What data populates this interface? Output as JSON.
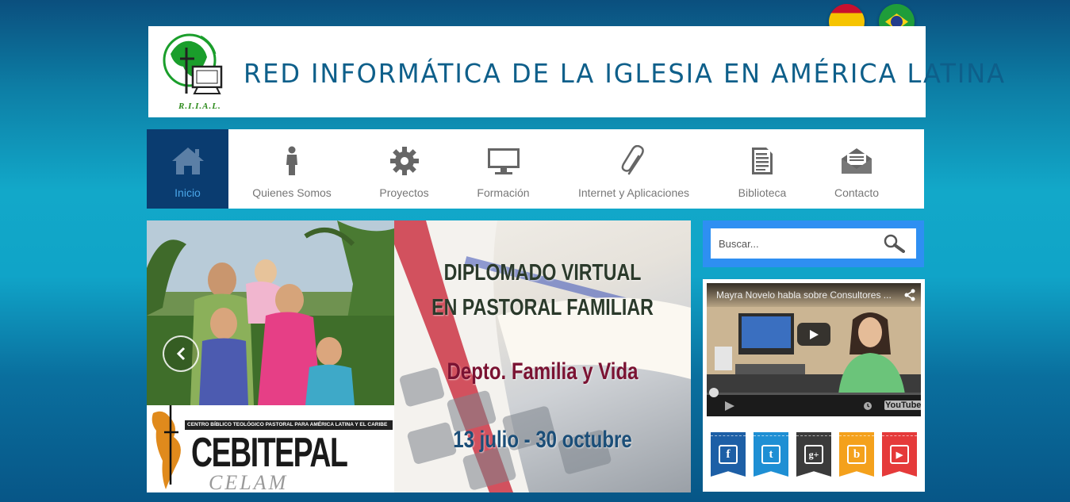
{
  "languages": [
    {
      "name": "Español",
      "flag": "spain-flag"
    },
    {
      "name": "Português",
      "flag": "brazil-flag"
    }
  ],
  "header": {
    "logo_text": "R.I.I.A.L.",
    "title": "RED INFORMÁTICA DE LA IGLESIA EN AMÉRICA LATINA"
  },
  "nav": {
    "items": [
      {
        "label": "Inicio",
        "icon": "home-icon",
        "active": true
      },
      {
        "label": "Quienes Somos",
        "icon": "person-icon"
      },
      {
        "label": "Proyectos",
        "icon": "gear-icon"
      },
      {
        "label": "Formación",
        "icon": "monitor-icon"
      },
      {
        "label": "Internet y Aplicaciones",
        "icon": "paperclip-icon"
      },
      {
        "label": "Biblioteca",
        "icon": "document-icon"
      },
      {
        "label": "Contacto",
        "icon": "envelope-icon"
      }
    ]
  },
  "slider": {
    "cebitepal_subtitle": "CENTRO BÍBLICO TEOLÓGICO PASTORAL PARA AMÉRICA LATINA Y EL CARIBE",
    "cebitepal_name": "CEBITEPAL",
    "celam": "CELAM",
    "line1": "DIPLOMADO VIRTUAL",
    "line2": "EN PASTORAL FAMILIAR",
    "department": "Depto. Familia y Vida",
    "dates": "13 julio - 30 octubre"
  },
  "search": {
    "placeholder": "Buscar..."
  },
  "video": {
    "title": "Mayra Novelo habla sobre Consultores ...",
    "brand": "YouTube",
    "progress": 0
  },
  "socials": [
    {
      "name": "facebook",
      "glyph": "f",
      "color": "#1d5fa6"
    },
    {
      "name": "twitter",
      "glyph": "t",
      "color": "#1e8fd4"
    },
    {
      "name": "google-plus",
      "glyph": "g+",
      "color": "#3b3b3b"
    },
    {
      "name": "blogger",
      "glyph": "b",
      "color": "#f4a11c"
    },
    {
      "name": "youtube",
      "glyph": "▶",
      "color": "#e53a3a"
    }
  ],
  "colors": {
    "nav_active_bg": "#0a3c70",
    "nav_active_text": "#4aa6e8",
    "title_color": "#0e5f8a",
    "search_frame": "#2e8ff2"
  }
}
